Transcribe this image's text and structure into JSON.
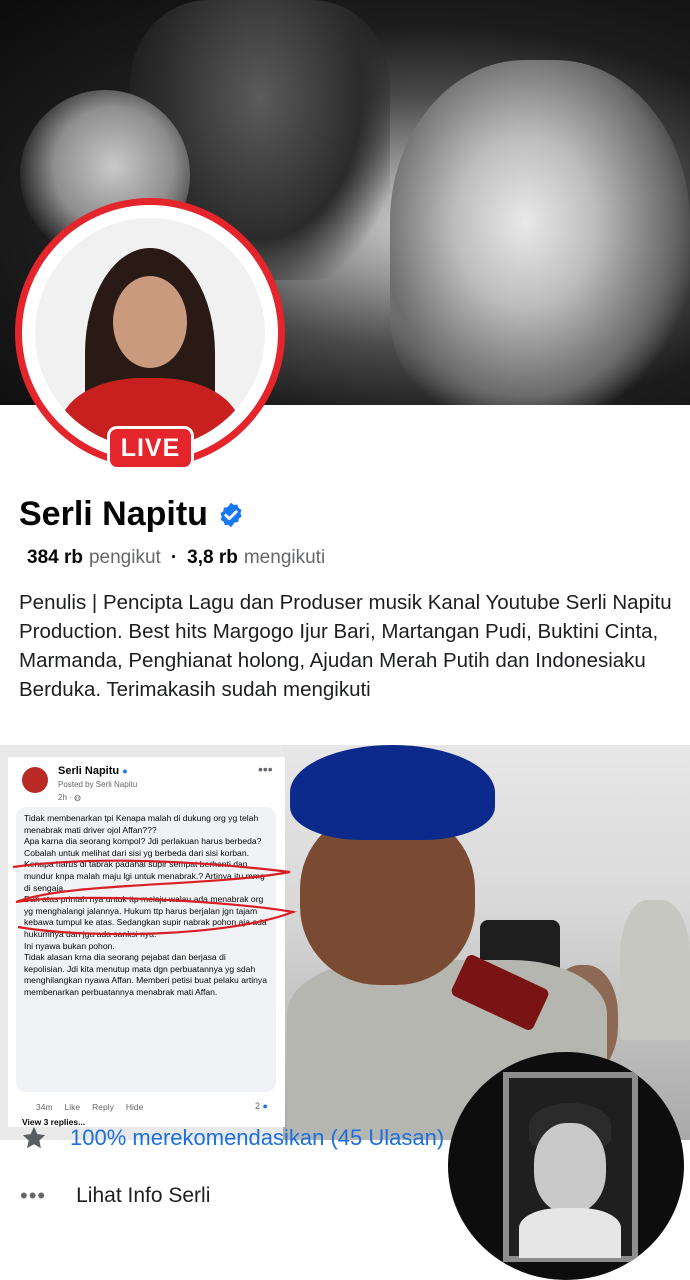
{
  "profile": {
    "name": "Serli Napitu",
    "live_badge": "LIVE",
    "followers_count": "384 rb",
    "followers_label": "pengikut",
    "following_count": "3,8 rb",
    "following_label": "mengikuti",
    "bio": "Penulis | Pencipta Lagu dan Produser musik Kanal Youtube Serli Napitu Production. Best hits Margogo Ijur Bari, Martangan Pudi, Buktini Cinta, Marmanda, Penghianat holong, Ajudan Merah Putih dan Indonesiaku Berduka. Terimakasih sudah mengikuti",
    "verified_icon": "verified-badge-icon"
  },
  "embedded_post": {
    "author": "Serli Napitu",
    "posted_by": "Posted by Serli Napitu",
    "time": "2h ·",
    "comment_lines": [
      "Tidak membenarkan tpi Kenapa malah di dukung org yg telah  menabrak mati driver ojol Affan???",
      "Apa karna dia seorang kompol? Jdi perlakuan harus berbeda? Cobalah untuk melihat dari sisi yg berbeda dari sisi korban. Kenapa harus di tabrak padahal supir sempat berhenti dan mundur knpa malah maju lgi untuk menabrak.? Artinya itu mmg di sengaja.",
      "Dan atas printah nya untuk ttp melaju walau ada menabrak org yg menghalangi jalannya. Hukum ttp harus berjalan jgn tajam kebawa tumpul ke atas. Sedangkan supir nabrak pohon aja ada hukumnya dan jga ada sanksi nya.",
      "Ini nyawa bukan pohon.",
      "Tidak alasan krna dia seorang pejabat dan berjasa  di kepolisian. Jdi kita menutup mata dgn perbuatannya yg sdah menghilangkan nyawa Affan. Memberi petisi buat pelaku artinya membenarkan perbuatannya menabrak mati Affan."
    ],
    "comment_age": "34m",
    "like_label": "Like",
    "reply_label": "Reply",
    "hide_label": "Hide",
    "reaction_count": "2",
    "view_replies": "View 3 replies..."
  },
  "recommend_row": {
    "icon": "star-icon",
    "text": "100% merekomendasikan (45 Ulasan)"
  },
  "info_row": {
    "icon": "more-dots-icon",
    "dots": "•••",
    "text": "Lihat Info Serli"
  },
  "colors": {
    "live_red": "#e4252c",
    "link_blue": "#1b6fe0",
    "verified_blue": "#1877f2"
  }
}
